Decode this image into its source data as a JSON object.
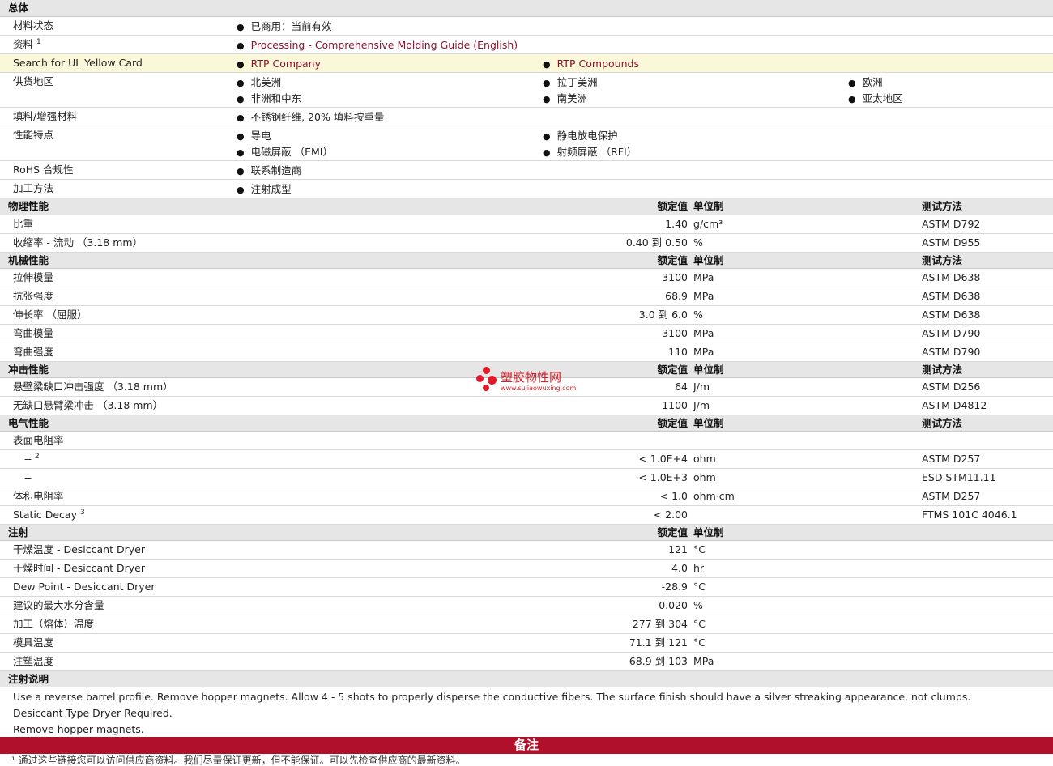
{
  "sections": {
    "general": "总体",
    "physical": "物理性能",
    "mechanical": "机械性能",
    "impact": "冲击性能",
    "electrical": "电气性能",
    "injection": "注射",
    "injection_notes": "注射说明"
  },
  "headers": {
    "nominal": "额定值",
    "unit": "单位制",
    "test": "测试方法"
  },
  "general": {
    "status_label": "材料状态",
    "status_value": "已商用：当前有效",
    "doc_label": "资料",
    "doc_sup": "1",
    "doc_link": "Processing - Comprehensive Molding Guide (English)",
    "ul_label": "Search for UL Yellow Card",
    "ul_link1": "RTP Company",
    "ul_link2": "RTP Compounds",
    "region_label": "供货地区",
    "regions": [
      "北美洲",
      "拉丁美洲",
      "欧洲",
      "非洲和中东",
      "南美洲",
      "亚太地区"
    ],
    "filler_label": "填料/增强材料",
    "filler_value": "不锈钢纤维, 20% 填料按重量",
    "features_label": "性能特点",
    "features": [
      "导电",
      "静电放电保护",
      "电磁屏蔽 （EMI）",
      "射频屏蔽 （RFI）"
    ],
    "rohs_label": "RoHS 合规性",
    "rohs_value": "联系制造商",
    "method_label": "加工方法",
    "method_value": "注射成型"
  },
  "physical": [
    {
      "name": "比重",
      "value": "1.40",
      "unit": "g/cm³",
      "test": "ASTM D792"
    },
    {
      "name": "收缩率  - 流动 （3.18 mm）",
      "value": "0.40 到  0.50",
      "unit": "%",
      "test": "ASTM D955"
    }
  ],
  "mechanical": [
    {
      "name": "拉伸模量",
      "value": "3100",
      "unit": "MPa",
      "test": "ASTM D638"
    },
    {
      "name": "抗张强度",
      "value": "68.9",
      "unit": "MPa",
      "test": "ASTM D638"
    },
    {
      "name": "伸长率 （屈服）",
      "value": "3.0 到  6.0",
      "unit": "%",
      "test": "ASTM D638"
    },
    {
      "name": "弯曲模量",
      "value": "3100",
      "unit": "MPa",
      "test": "ASTM D790"
    },
    {
      "name": "弯曲强度",
      "value": "110",
      "unit": "MPa",
      "test": "ASTM D790"
    }
  ],
  "impact": [
    {
      "name": "悬壁梁缺口冲击强度 （3.18 mm）",
      "value": "64",
      "unit": "J/m",
      "test": "ASTM D256"
    },
    {
      "name": "无缺口悬臂梁冲击 （3.18 mm）",
      "value": "1100",
      "unit": "J/m",
      "test": "ASTM D4812"
    }
  ],
  "electrical": {
    "surface_label": "表面电阻率",
    "sub1_name": "--",
    "sub1_sup": "2",
    "sub1_value": "< 1.0E+4",
    "sub1_unit": "ohm",
    "sub1_test": "ASTM D257",
    "sub2_name": "--",
    "sub2_value": "< 1.0E+3",
    "sub2_unit": "ohm",
    "sub2_test": "ESD STM11.11",
    "volume_name": "体积电阻率",
    "volume_value": "< 1.0",
    "volume_unit": "ohm·cm",
    "volume_test": "ASTM D257",
    "decay_name": "Static Decay",
    "decay_sup": "3",
    "decay_value": "< 2.00",
    "decay_test": "FTMS 101C 4046.1"
  },
  "injection": [
    {
      "name": "干燥温度  - Desiccant Dryer",
      "value": "121",
      "unit": "°C"
    },
    {
      "name": "干燥时间  - Desiccant Dryer",
      "value": "4.0",
      "unit": "hr"
    },
    {
      "name": "Dew Point - Desiccant Dryer",
      "value": "-28.9",
      "unit": "°C"
    },
    {
      "name": "建议的最大水分含量",
      "value": "0.020",
      "unit": "%"
    },
    {
      "name": "加工（熔体）温度",
      "value": "277 到  304",
      "unit": "°C"
    },
    {
      "name": "模具温度",
      "value": "71.1 到  121",
      "unit": "°C"
    },
    {
      "name": "注塑温度",
      "value": "68.9 到  103",
      "unit": "MPa"
    }
  ],
  "injection_notes_lines": [
    "Use a reverse barrel profile. Remove hopper magnets. Allow 4 - 5 shots to properly disperse the conductive fibers. The surface finish should have a silver streaking appearance, not clumps.",
    "Desiccant Type Dryer Required.",
    "Remove hopper magnets."
  ],
  "notes_bar": "备注",
  "footnote": "¹ 通过这些链接您可以访问供应商资料。我们尽量保证更新，但不能保证。可以先检查供应商的最新资料。",
  "watermark": {
    "text": "塑胶物性网",
    "url": "www.sujiaowuxing.com",
    "color": "#d81f2a"
  }
}
